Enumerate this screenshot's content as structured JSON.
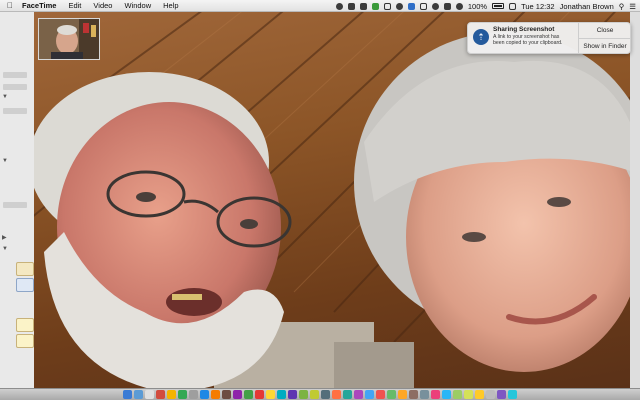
{
  "menubar": {
    "app_name": "FaceTime",
    "items": [
      "Edit",
      "Video",
      "Window",
      "Help"
    ],
    "battery": "100%",
    "clock": "Tue 12:32",
    "user": "Jonathan Brown"
  },
  "notification": {
    "title": "Sharing Screenshot",
    "body": "A link to your screenshot has been copied to your clipboard.",
    "close_label": "Close",
    "show_label": "Show in Finder"
  },
  "colors": {
    "notification_icon": "#245a9c",
    "wood": "#8c5527"
  },
  "dock": {
    "icon_colors": [
      "#3a7bd5",
      "#5b9bd5",
      "#e0e0e0",
      "#d24c3e",
      "#f4b400",
      "#34a853",
      "#9e9e9e",
      "#1e88e5",
      "#f57c00",
      "#6d4c41",
      "#8e24aa",
      "#43a047",
      "#e53935",
      "#fdd835",
      "#00acc1",
      "#5e35b1",
      "#7cb342",
      "#c0ca33",
      "#546e7a",
      "#ff7043",
      "#26a69a",
      "#ab47bc",
      "#42a5f5",
      "#ef5350",
      "#66bb6a",
      "#ffa726",
      "#8d6e63",
      "#78909c",
      "#ec407a",
      "#29b6f6",
      "#9ccc65",
      "#d4e157",
      "#ffca28",
      "#bdbdbd",
      "#7e57c2",
      "#26c6da"
    ]
  }
}
